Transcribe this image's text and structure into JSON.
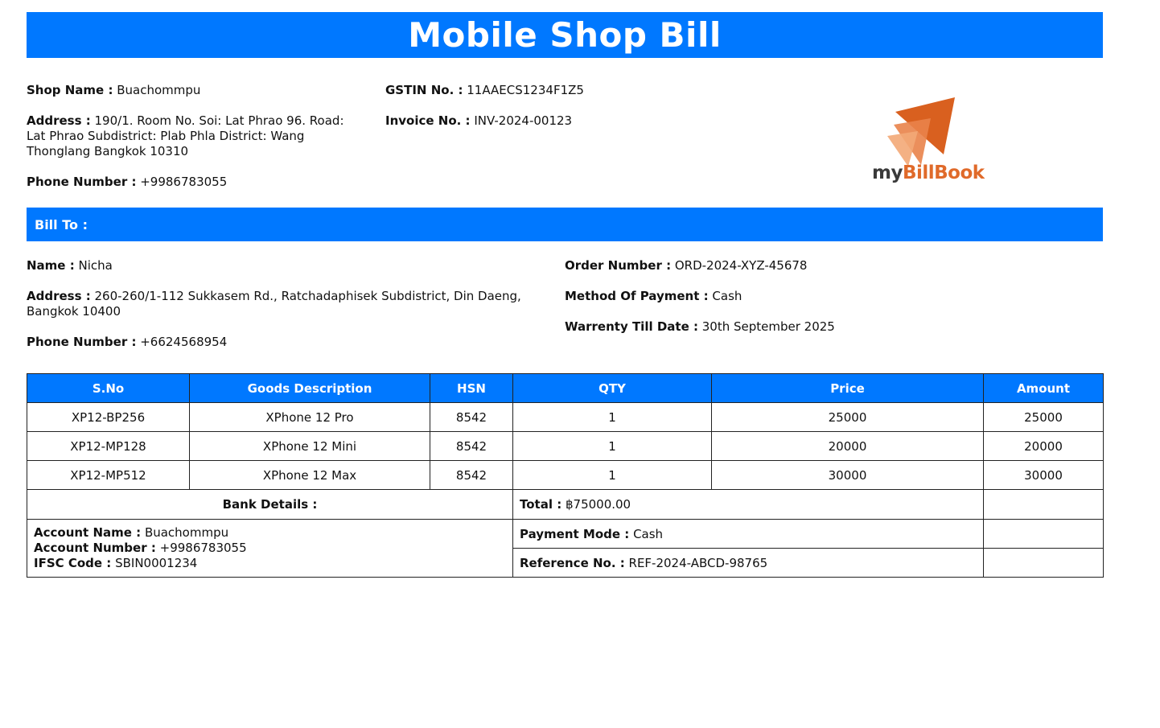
{
  "header": {
    "title": "Mobile Shop Bill"
  },
  "shop": {
    "name_label": "Shop Name :",
    "name": "Buachommpu",
    "address_label": "Address :",
    "address": "190/1. Room No. Soi: Lat Phrao 96. Road: Lat Phrao Subdistrict: Plab Phla District: Wang Thonglang Bangkok 10310",
    "phone_label": "Phone Number :",
    "phone": "+9986783055",
    "gstin_label": "GSTIN No. :",
    "gstin": "11AAECS1234F1Z5",
    "invoice_label": "Invoice No. :",
    "invoice": "INV-2024-00123"
  },
  "logo": {
    "icon": "mybillbook-logo-icon",
    "text_my": "my",
    "text_brand": "BillBook",
    "colors": {
      "primary": "#d9601f",
      "secondary": "#f0a070"
    }
  },
  "bill_to": {
    "heading": "Bill To :",
    "name_label": "Name :",
    "name": "Nicha",
    "address_label": "Address :",
    "address": "260-260/1-112 Sukkasem Rd., Ratchadaphisek Subdistrict, Din Daeng, Bangkok 10400",
    "phone_label": "Phone Number :",
    "phone": "+6624568954",
    "order_label": "Order Number :",
    "order": "ORD-2024-XYZ-45678",
    "payment_method_label": "Method Of Payment :",
    "payment_method": "Cash",
    "warranty_label": "Warrenty Till Date :",
    "warranty": "30th September 2025"
  },
  "items_table": {
    "headers": [
      "S.No",
      "Goods Description",
      "HSN",
      "QTY",
      "Price",
      "Amount"
    ],
    "rows": [
      [
        "XP12-BP256",
        "XPhone 12 Pro",
        "8542",
        "1",
        "25000",
        "25000"
      ],
      [
        "XP12-MP128",
        "XPhone 12 Mini",
        "8542",
        "1",
        "20000",
        "20000"
      ],
      [
        "XP12-MP512",
        "XPhone 12 Max",
        "8542",
        "1",
        "30000",
        "30000"
      ]
    ]
  },
  "summary": {
    "bank_details_label": "Bank Details :",
    "account_name_label": "Account Name :",
    "account_name": "Buachommpu",
    "account_number_label": "Account Number :",
    "account_number": "+9986783055",
    "ifsc_label": "IFSC Code :",
    "ifsc": "SBIN0001234",
    "total_label": "Total :",
    "total": "฿75000.00",
    "payment_mode_label": "Payment Mode :",
    "payment_mode": "Cash",
    "reference_label": "Reference No. :",
    "reference": "REF-2024-ABCD-98765"
  },
  "colors": {
    "accent": "#0078ff",
    "border": "#222222"
  }
}
